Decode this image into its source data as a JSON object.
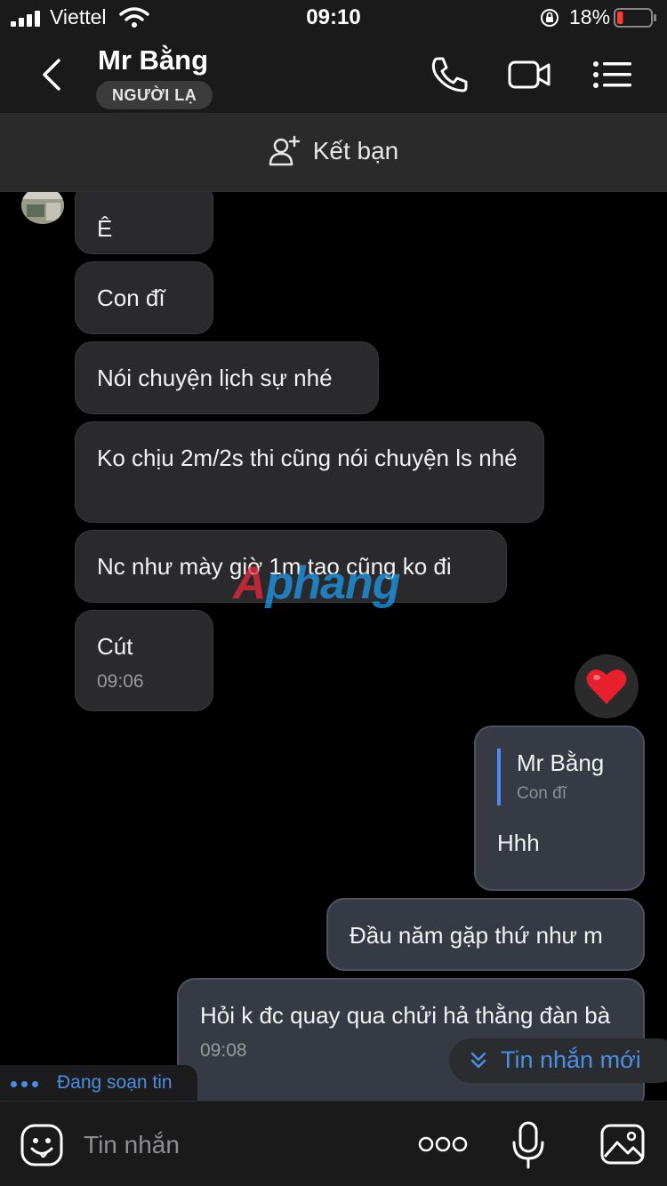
{
  "status_bar": {
    "carrier": "Viettel",
    "time": "09:10",
    "battery_percent": "18%",
    "battery_level": 0.18,
    "icons": [
      "signal-icon",
      "wifi-icon",
      "rotation-lock-icon",
      "battery-icon"
    ]
  },
  "header": {
    "contact_name": "Mr Bằng",
    "badge": "NGƯỜI LẠ",
    "icons": [
      "back-chevron-icon",
      "phone-icon",
      "video-camera-icon",
      "list-menu-icon"
    ]
  },
  "add_friend": {
    "label": "Kết bạn",
    "icon": "add-person-icon"
  },
  "messages": {
    "incoming": [
      {
        "text": "Ê"
      },
      {
        "text": "Con đĩ"
      },
      {
        "text": "Nói chuyện lịch sự nhé"
      },
      {
        "text": "Ko chịu 2m/2s thi cũng nói chuyện ls nhé"
      },
      {
        "text": "Nc như mày giờ 1m tao cũng ko đi"
      },
      {
        "text": "Cút",
        "time": "09:06"
      }
    ],
    "reaction": "heart",
    "outgoing": [
      {
        "quote_name": "Mr Bằng",
        "quote_text": "Con đĩ",
        "text": "Hhh"
      },
      {
        "text": "Đầu năm gặp thứ như m"
      },
      {
        "text": "Hỏi k đc quay qua chửi hả thằng đàn bà",
        "time": "09:08"
      }
    ]
  },
  "watermark": {
    "prefix": "A",
    "rest": "phang"
  },
  "typing_indicator": "Đang soạn tin",
  "new_message_button": "Tin nhắn mới",
  "composer": {
    "placeholder": "Tin nhắn",
    "icons": [
      "emoji-icon",
      "more-dots-icon",
      "microphone-icon",
      "image-icon"
    ]
  },
  "colors": {
    "accent": "#4a90e2",
    "heart": "#e8202e",
    "background": "#000000",
    "bubble_in": "#2a2a2c",
    "bubble_out": "#363a45"
  }
}
